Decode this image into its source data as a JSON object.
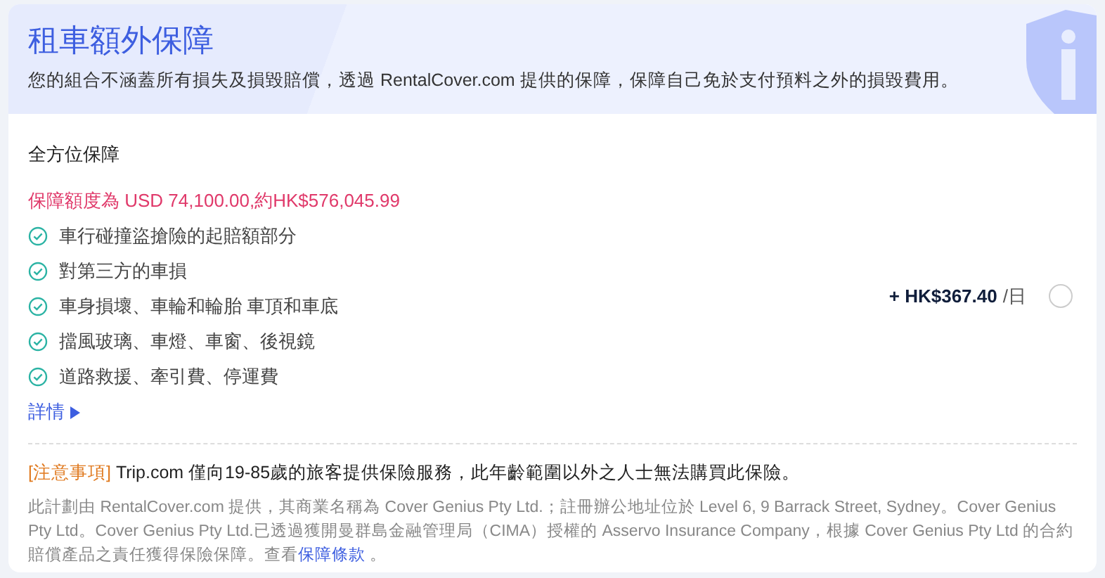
{
  "header": {
    "title": "租車額外保障",
    "subtitle": "您的組合不涵蓋所有損失及損毀賠償，透過 RentalCover.com 提供的保障，保障自己免於支付預料之外的損毀費用。"
  },
  "plan": {
    "name": "全方位保障",
    "coverage": "保障額度為 USD 74,100.00,約HK$576,045.99",
    "features": [
      "車行碰撞盜搶險的起賠額部分",
      "對第三方的車損",
      "車身損壞、車輪和輪胎 車頂和車底",
      "擋風玻璃、車燈、車窗、後視鏡",
      "道路救援、牽引費、停運費"
    ],
    "details_link": "詳情",
    "price": "+ HK$367.40",
    "unit": "/日",
    "selected": false
  },
  "notice": {
    "label": "[注意事項]",
    "text": "Trip.com 僅向19-85歲的旅客提供保險服務，此年齡範圍以外之人士無法購買此保險。"
  },
  "footer": {
    "text": "此計劃由 RentalCover.com 提供，其商業名稱為 Cover Genius Pty Ltd.；註冊辦公地址位於 Level 6, 9 Barrack Street, Sydney。Cover Genius Pty Ltd。Cover Genius Pty Ltd.已透過獲開曼群島金融管理局（CIMA）授權的 Asservo Insurance Company，根據 Cover Genius Pty Ltd 的合約賠償產品之責任獲得保險保障。查看",
    "link": "保障條款",
    "after": " 。"
  }
}
